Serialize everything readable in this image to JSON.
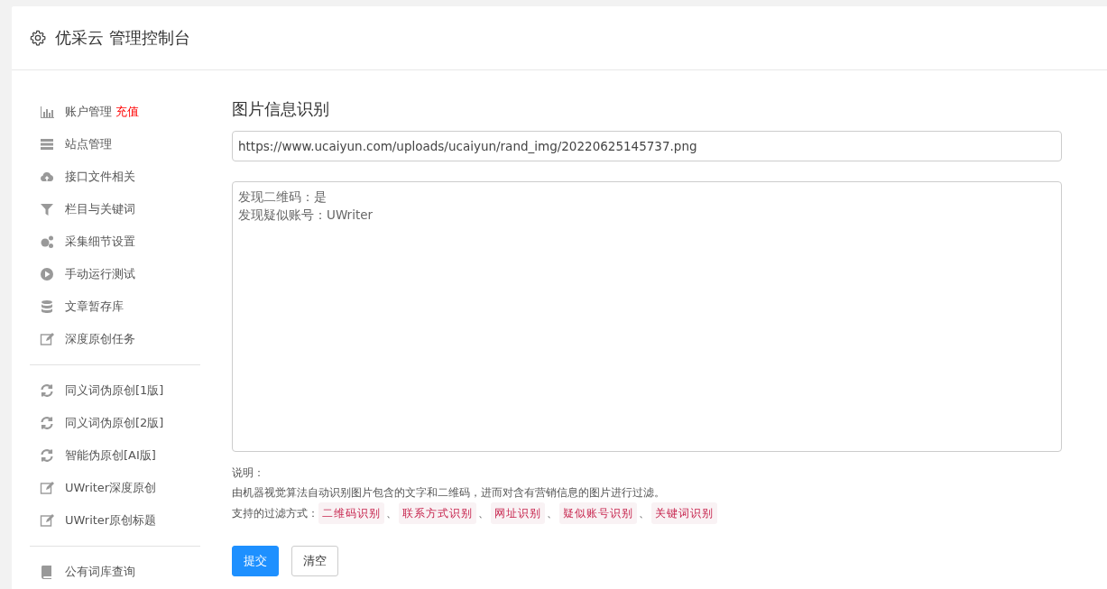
{
  "header": {
    "title": "优采云 管理控制台"
  },
  "sidebar": {
    "groups": [
      {
        "items": [
          {
            "label": "账户管理",
            "badge": "充值"
          },
          {
            "label": "站点管理"
          },
          {
            "label": "接口文件相关"
          },
          {
            "label": "栏目与关键词"
          },
          {
            "label": "采集细节设置"
          },
          {
            "label": "手动运行测试"
          },
          {
            "label": "文章暂存库"
          },
          {
            "label": "深度原创任务"
          }
        ]
      },
      {
        "items": [
          {
            "label": "同义词伪原创[1版]"
          },
          {
            "label": "同义词伪原创[2版]"
          },
          {
            "label": "智能伪原创[AI版]"
          },
          {
            "label": "UWriter深度原创"
          },
          {
            "label": "UWriter原创标题"
          }
        ]
      },
      {
        "items": [
          {
            "label": "公有词库查询"
          }
        ]
      }
    ]
  },
  "main": {
    "heading": "图片信息识别",
    "url_field": {
      "value": "https://www.ucaiyun.com/uploads/ucaiyun/rand_img/20220625145737.png"
    },
    "result_field": {
      "lines": [
        "发现二维码：是",
        "发现疑似账号：UWriter"
      ]
    },
    "notes": {
      "title": "说明：",
      "description": "由机器视觉算法自动识别图片包含的文字和二维码，进而对含有营销信息的图片进行过滤。",
      "filter_label": "支持的过滤方式：",
      "tags": [
        "二维码识别",
        "联系方式识别",
        "网址识别",
        "疑似账号识别",
        "关键词识别"
      ],
      "separators": [
        "、",
        "、",
        "、",
        "、"
      ]
    },
    "buttons": [
      {
        "label": "提交",
        "kind": "primary"
      },
      {
        "label": "清空",
        "kind": "default"
      }
    ]
  }
}
